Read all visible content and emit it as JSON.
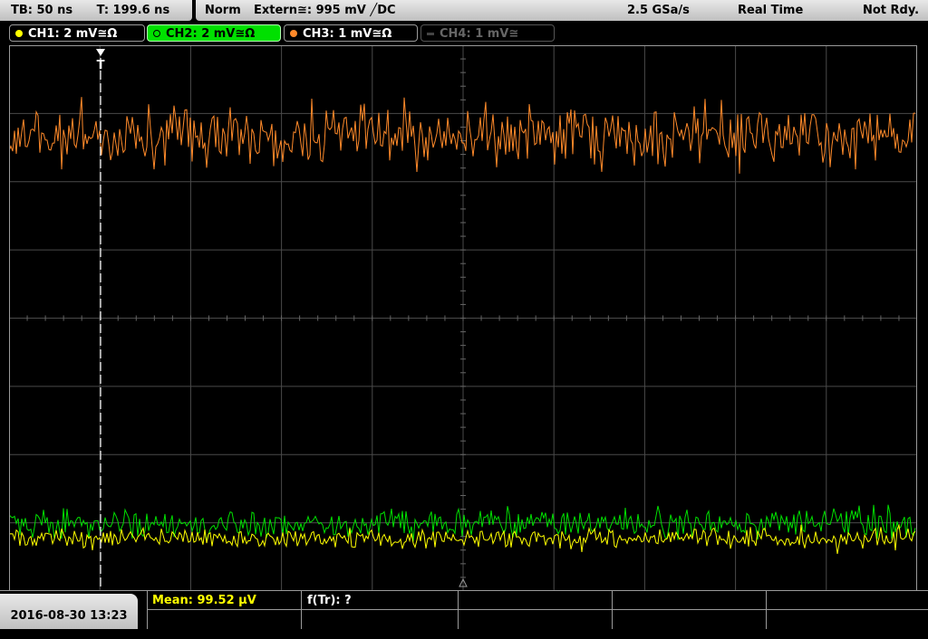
{
  "status": {
    "timebase": "TB: 50 ns",
    "trigger_time": "T: 199.6 ns",
    "mode": "Norm",
    "trigger_source": "Extern≅: 995 mV ╱DC",
    "sample_rate": "2.5 GSa/s",
    "acq_mode": "Real Time",
    "run_state": "Not Rdy."
  },
  "channels": [
    {
      "label": "CH1: 2 mV≅Ω",
      "color": "#ffff00",
      "active": false
    },
    {
      "label": "CH2: 2 mV≅Ω",
      "color": "#00e000",
      "active": true
    },
    {
      "label": "CH3: 1 mV≅Ω",
      "color": "#ff8a2a",
      "active": false
    },
    {
      "label": "CH4: 1 mV≅",
      "color": "#555555",
      "active": false
    }
  ],
  "screen": {
    "trigger_marker": "T",
    "grid": {
      "h_divs": 10,
      "v_divs": 8
    }
  },
  "bottom": {
    "datetime": "2016-08-30 13:23",
    "measurement_mean": "Mean: 99.52 µV",
    "measurement_freq": "f(Tr): ?"
  },
  "colors": {
    "ch1": "#ffff00",
    "ch2": "#00e000",
    "ch3": "#ff8a2a",
    "grid": "#4a4a4a",
    "frame": "#9a9a9a"
  }
}
